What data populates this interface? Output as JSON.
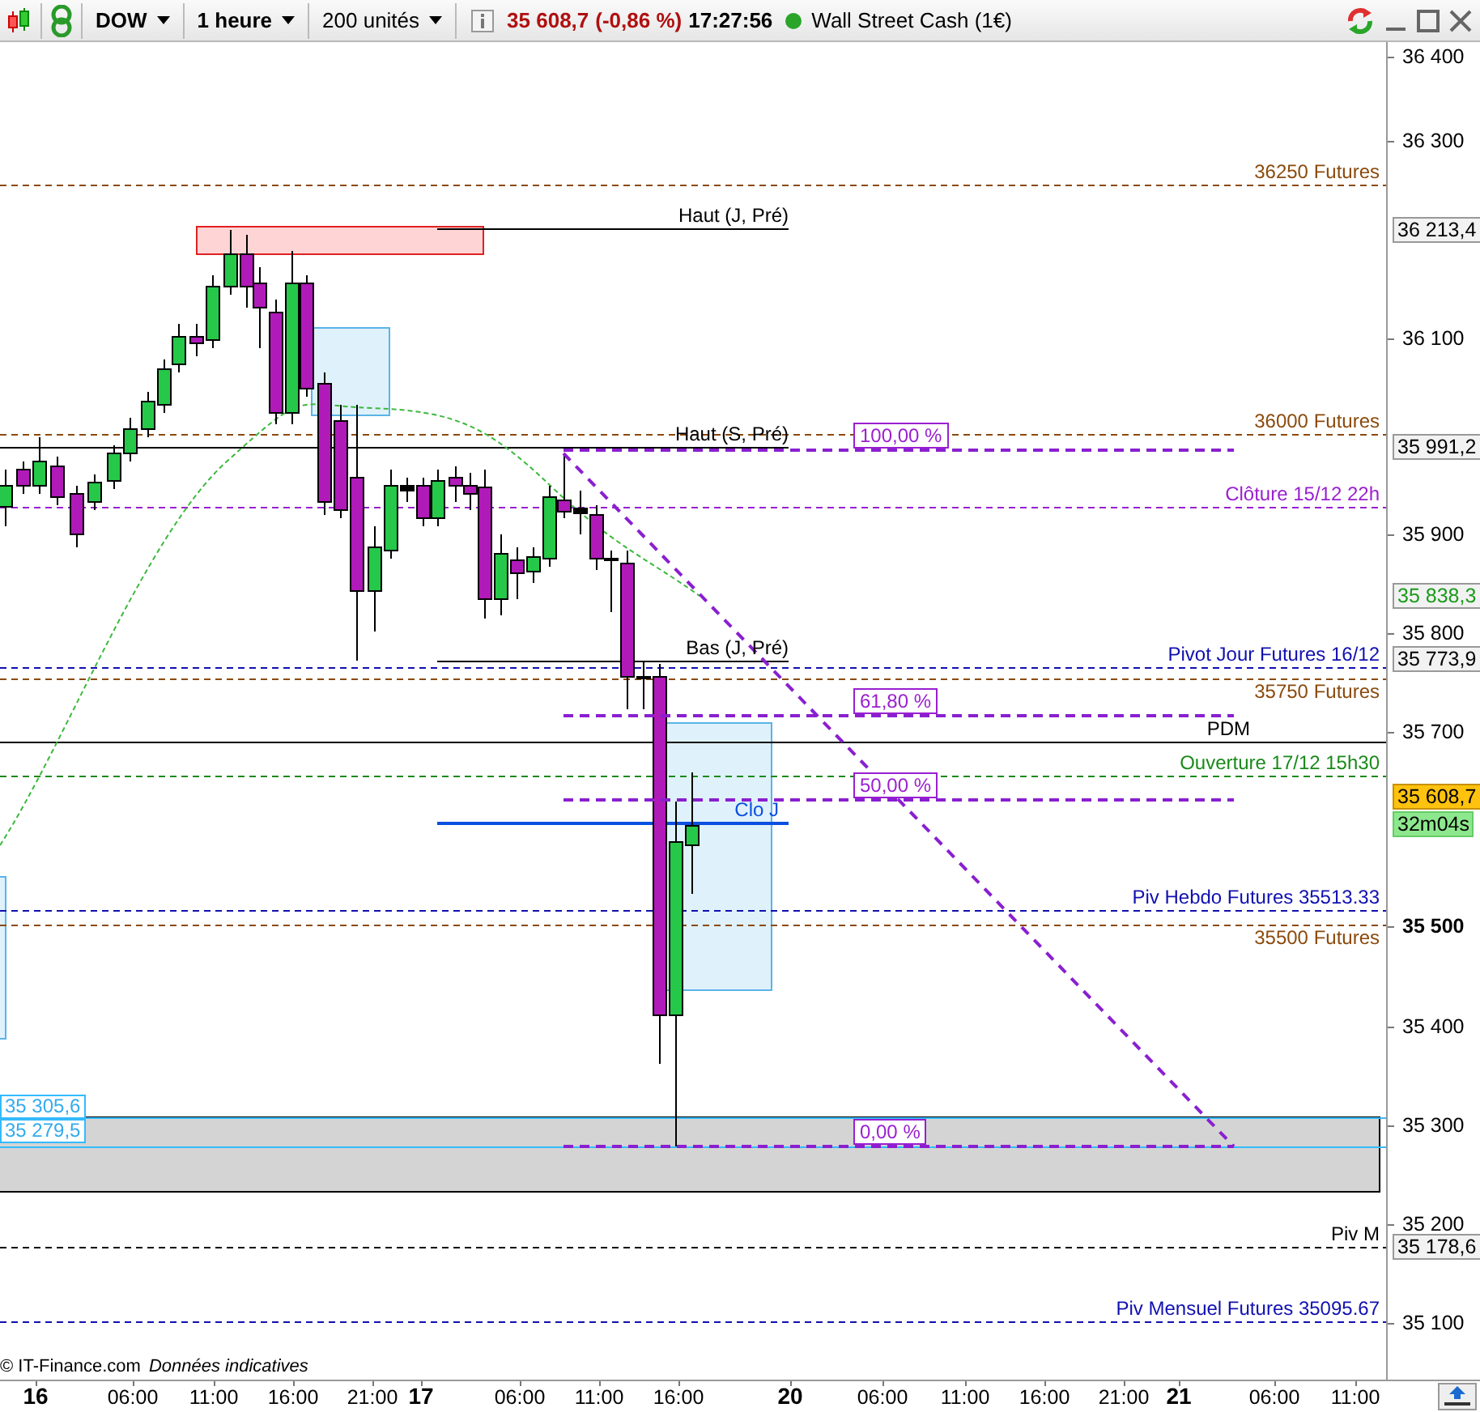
{
  "toolbar": {
    "instrument": "DOW",
    "timeframe": "1 heure",
    "units": "200 unités",
    "last_price": "35 608,7",
    "change": "(-0,86 %)",
    "time": "17:27:56",
    "market_open": true,
    "market": "Wall Street Cash (1€)"
  },
  "levels": [
    {
      "label": "36250 Futures",
      "color": "#8b4a0c",
      "kind": "dashed"
    },
    {
      "label": "Haut (J, Pré)",
      "color": "#000000",
      "kind": "solid"
    },
    {
      "label": "36000 Futures",
      "color": "#8b4a0c",
      "kind": "dashed"
    },
    {
      "label": "Haut (S, Pré)",
      "color": "#000000",
      "kind": "solid"
    },
    {
      "label": "Clôture 15/12 22h",
      "color": "#9a1fd0",
      "kind": "dashed"
    },
    {
      "label": "Bas (J, Pré)",
      "color": "#000000",
      "kind": "solid"
    },
    {
      "label": "Pivot Jour Futures 16/12",
      "color": "#1010b0",
      "kind": "dashed"
    },
    {
      "label": "35750 Futures",
      "color": "#8b4a0c",
      "kind": "dashed"
    },
    {
      "label": "PDM",
      "color": "#000000",
      "kind": "solid"
    },
    {
      "label": "Ouverture 17/12 15h30",
      "color": "#1a8a1a",
      "kind": "dashed"
    },
    {
      "label": "Clo J",
      "color": "#0a4fe0",
      "kind": "solid"
    },
    {
      "label": "Piv Hebdo Futures 35513.33",
      "color": "#1010b0",
      "kind": "dashed"
    },
    {
      "label": "35500 Futures",
      "color": "#8b4a0c",
      "kind": "dashed"
    },
    {
      "label": "Piv M",
      "color": "#000000",
      "kind": "dashed"
    },
    {
      "label": "Piv Mensuel Futures 35095.67",
      "color": "#1010b0",
      "kind": "dashed"
    }
  ],
  "fibonacci": [
    {
      "label": "100,00 %"
    },
    {
      "label": "61,80 %"
    },
    {
      "label": "50,00 %"
    },
    {
      "label": "0,00 %"
    }
  ],
  "zone_tags": [
    {
      "label": "35 305,6"
    },
    {
      "label": "35 279,5"
    }
  ],
  "price_axis": {
    "ticks": [
      {
        "label": "36 400",
        "bold": false
      },
      {
        "label": "36 300",
        "bold": false
      },
      {
        "label": "36 100",
        "bold": false
      },
      {
        "label": "35 900",
        "bold": false
      },
      {
        "label": "35 800",
        "bold": false
      },
      {
        "label": "35 700",
        "bold": false
      },
      {
        "label": "35 500",
        "bold": true
      },
      {
        "label": "35 400",
        "bold": false
      },
      {
        "label": "35 300",
        "bold": false
      },
      {
        "label": "35 200",
        "bold": false
      },
      {
        "label": "35 100",
        "bold": false
      }
    ],
    "tags": [
      {
        "label": "36 213,4",
        "kind": "level"
      },
      {
        "label": "35 991,2",
        "kind": "level"
      },
      {
        "label": "35 838,3",
        "kind": "average"
      },
      {
        "label": "35 773,9",
        "kind": "level"
      },
      {
        "label": "35 608,7",
        "kind": "last"
      },
      {
        "label": "32m04s",
        "kind": "countdown"
      },
      {
        "label": "35 178,6",
        "kind": "level"
      }
    ]
  },
  "footer": {
    "copyright": "© IT-Finance.com",
    "note": "Données indicatives"
  },
  "time_axis": [
    {
      "label": "16",
      "kind": "day"
    },
    {
      "label": "06:00",
      "kind": "hour"
    },
    {
      "label": "11:00",
      "kind": "hour"
    },
    {
      "label": "16:00",
      "kind": "hour"
    },
    {
      "label": "21:00",
      "kind": "hour"
    },
    {
      "label": "17",
      "kind": "day"
    },
    {
      "label": "06:00",
      "kind": "hour"
    },
    {
      "label": "11:00",
      "kind": "hour"
    },
    {
      "label": "16:00",
      "kind": "hour"
    },
    {
      "label": "20",
      "kind": "day"
    },
    {
      "label": "06:00",
      "kind": "hour"
    },
    {
      "label": "11:00",
      "kind": "hour"
    },
    {
      "label": "16:00",
      "kind": "hour"
    },
    {
      "label": "21:00",
      "kind": "hour"
    },
    {
      "label": "21",
      "kind": "day"
    },
    {
      "label": "06:00",
      "kind": "hour"
    },
    {
      "label": "11:00",
      "kind": "hour"
    }
  ]
}
